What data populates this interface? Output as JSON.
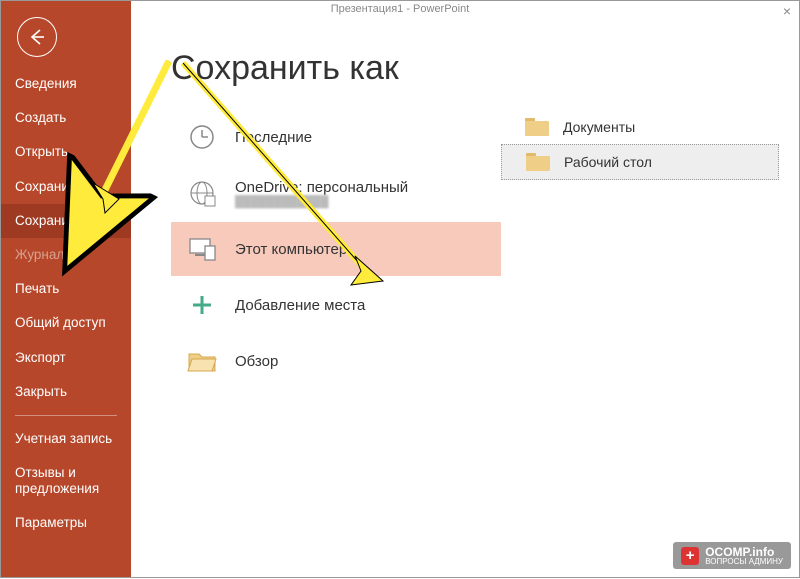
{
  "title_bar": "Презентация1 - PowerPoint",
  "page_title": "Сохранить как",
  "sidebar": {
    "items": [
      {
        "label": "Сведения",
        "active": false
      },
      {
        "label": "Создать",
        "active": false
      },
      {
        "label": "Открыть",
        "active": false
      },
      {
        "label": "Сохранить",
        "active": false
      },
      {
        "label": "Сохранить как",
        "active": true
      },
      {
        "label": "Журнал",
        "disabled": true
      },
      {
        "label": "Печать",
        "active": false
      },
      {
        "label": "Общий доступ",
        "active": false
      },
      {
        "label": "Экспорт",
        "active": false
      },
      {
        "label": "Закрыть",
        "active": false
      }
    ],
    "bottom_items": [
      {
        "label": "Учетная запись"
      },
      {
        "label": "Отзывы и предложения"
      },
      {
        "label": "Параметры"
      }
    ]
  },
  "locations": [
    {
      "label": "Последние",
      "icon": "clock"
    },
    {
      "label": "OneDrive: персональный",
      "icon": "onedrive",
      "sub": "hidden"
    },
    {
      "label": "Этот компьютер",
      "icon": "pc",
      "selected": true
    },
    {
      "label": "Добавление места",
      "icon": "add-place"
    },
    {
      "label": "Обзор",
      "icon": "browse"
    }
  ],
  "folders": [
    {
      "label": "Документы",
      "selected": false
    },
    {
      "label": "Рабочий стол",
      "selected": true
    }
  ],
  "watermark": {
    "brand": "OCOMP.info",
    "tagline": "ВОПРОСЫ АДМИНУ"
  }
}
